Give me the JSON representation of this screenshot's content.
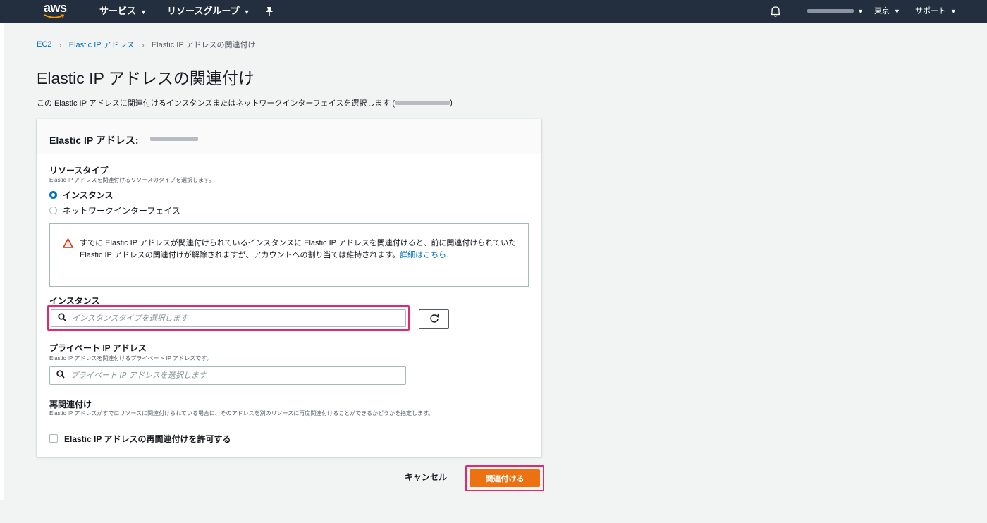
{
  "topnav": {
    "logo": "aws",
    "services": "サービス",
    "resource_groups": "リソースグループ",
    "region": "東京",
    "support": "サポート"
  },
  "breadcrumb": {
    "items": [
      "EC2",
      "Elastic IP アドレス"
    ],
    "current": "Elastic IP アドレスの関連付け"
  },
  "page": {
    "title": "Elastic IP アドレスの関連付け",
    "description_prefix": "この Elastic IP アドレスに関連付けるインスタンスまたはネットワークインターフェイスを選択します (",
    "description_suffix": ")"
  },
  "card": {
    "title": "Elastic IP アドレス:",
    "resource_type": {
      "label": "リソースタイプ",
      "description": "Elastic IP アドレスを関連付けるリソースのタイプを選択します。",
      "options": [
        {
          "label": "インスタンス",
          "selected": true
        },
        {
          "label": "ネットワークインターフェイス",
          "selected": false
        }
      ]
    },
    "warning": {
      "text": "すでに Elastic IP アドレスが関連付けられているインスタンスに Elastic IP アドレスを関連付けると、前に関連付けられていた Elastic IP アドレスの関連付けが解除されますが、アカウントへの割り当ては維持されます。",
      "link_text": "詳細はこちら",
      "suffix": "."
    },
    "instance": {
      "label": "インスタンス",
      "placeholder": "インスタンスタイプを選択します"
    },
    "private_ip": {
      "label": "プライベート IP アドレス",
      "description": "Elastic IP アドレスを関連付けるプライベート IP アドレスです。",
      "placeholder": "プライベート IP アドレスを選択します"
    },
    "reassociation": {
      "label": "再関連付け",
      "description": "Elastic IP アドレスがすでにリソースに関連付けられている場合に、そのアドレスを別のリソースに再度関連付けることができるかどうかを指定します。",
      "checkbox_label": "Elastic IP アドレスの再関連付けを許可する"
    }
  },
  "actions": {
    "cancel": "キャンセル",
    "associate": "関連付ける"
  },
  "colors": {
    "nav_bg": "#232f3e",
    "link": "#0073bb",
    "primary": "#ec7211",
    "highlight": "#e3286c",
    "page_bg": "#f2f3f3"
  }
}
